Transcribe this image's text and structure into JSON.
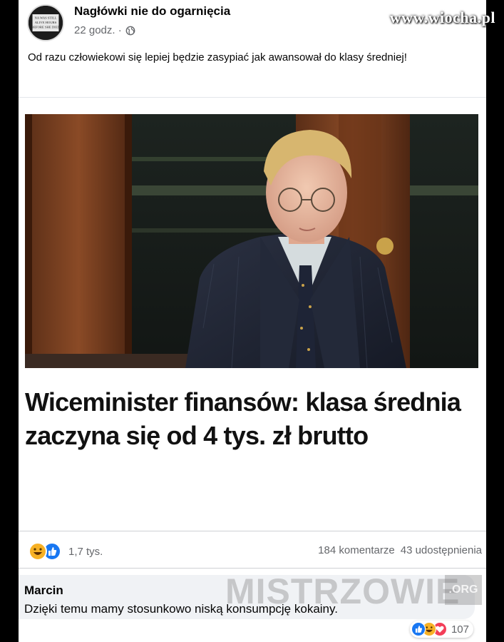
{
  "post": {
    "page_name": "Nagłówki nie do ogarnięcia",
    "time": "22 godz. ·",
    "privacy_icon": "globe-icon",
    "text": "Od razu człowiekowi się lepiej będzie zasypiać jak awansował do klasy średniej!",
    "avatar_lines": [
      "NA WAS STILL",
      "ALIVE HOURS",
      "BEFORE SHE DIED"
    ]
  },
  "link_preview": {
    "headline": "Wiceminister finansów: klasa średnia zaczyna się od 4 tys. zł brutto"
  },
  "engagement": {
    "reaction_icons": [
      "haha-icon",
      "like-icon"
    ],
    "reaction_count": "1,7 tys.",
    "comments": "184 komentarze",
    "shares": "43 udostępnienia"
  },
  "comment": {
    "author": "Marcin",
    "text": "Dzięki temu mamy stosunkowo niską konsumpcję kokainy.",
    "reaction_icons": [
      "like-icon",
      "haha-icon",
      "love-icon"
    ],
    "reaction_count": "107"
  },
  "watermarks": {
    "top": "www.wiocha.pl",
    "bottom": "MISTRZOWIE",
    "bottom_suffix": ".ORG"
  },
  "colors": {
    "facebook_blue": "#1877f2",
    "haha_yellow": "#f7b125",
    "love_red": "#f33e58",
    "comment_bg": "#f0f2f5"
  }
}
